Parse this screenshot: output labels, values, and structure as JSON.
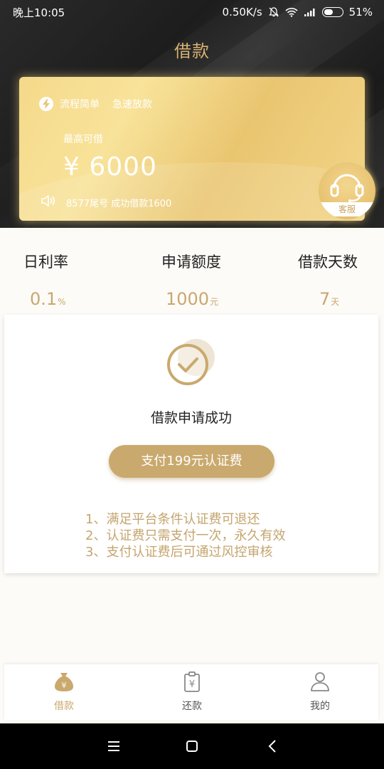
{
  "status_bar": {
    "time": "晚上10:05",
    "network_speed": "0.50K/s",
    "battery": "51%",
    "battery_level": 0.51
  },
  "header": {
    "title": "借款"
  },
  "card": {
    "tag1": "流程简单",
    "tag2": "急速放款",
    "max_label": "最高可借",
    "max_amount": "¥ 6000",
    "notice": "8577尾号 成功借款1600",
    "service_label": "客服"
  },
  "stats": {
    "labels": [
      "日利率",
      "申请额度",
      "借款天数"
    ],
    "values": [
      {
        "value": "0.1",
        "unit": "%"
      },
      {
        "value": "1000",
        "unit": "元"
      },
      {
        "value": "7",
        "unit": "天"
      }
    ]
  },
  "success": {
    "message": "借款申请成功",
    "pay_button": "支付199元认证费",
    "notes": [
      "1、满足平台条件认证费可退还",
      "2、认证费只需支付一次，永久有效",
      "3、支付认证费后可通过风控审核"
    ]
  },
  "tabs": [
    {
      "label": "借款",
      "icon": "money-bag-icon",
      "active": true
    },
    {
      "label": "还款",
      "icon": "repay-clipboard-icon",
      "active": false
    },
    {
      "label": "我的",
      "icon": "user-icon",
      "active": false
    }
  ],
  "colors": {
    "accent_gold": "#c9a96d",
    "title_gold": "#d6b272",
    "card_gold": "#f5d98a"
  }
}
